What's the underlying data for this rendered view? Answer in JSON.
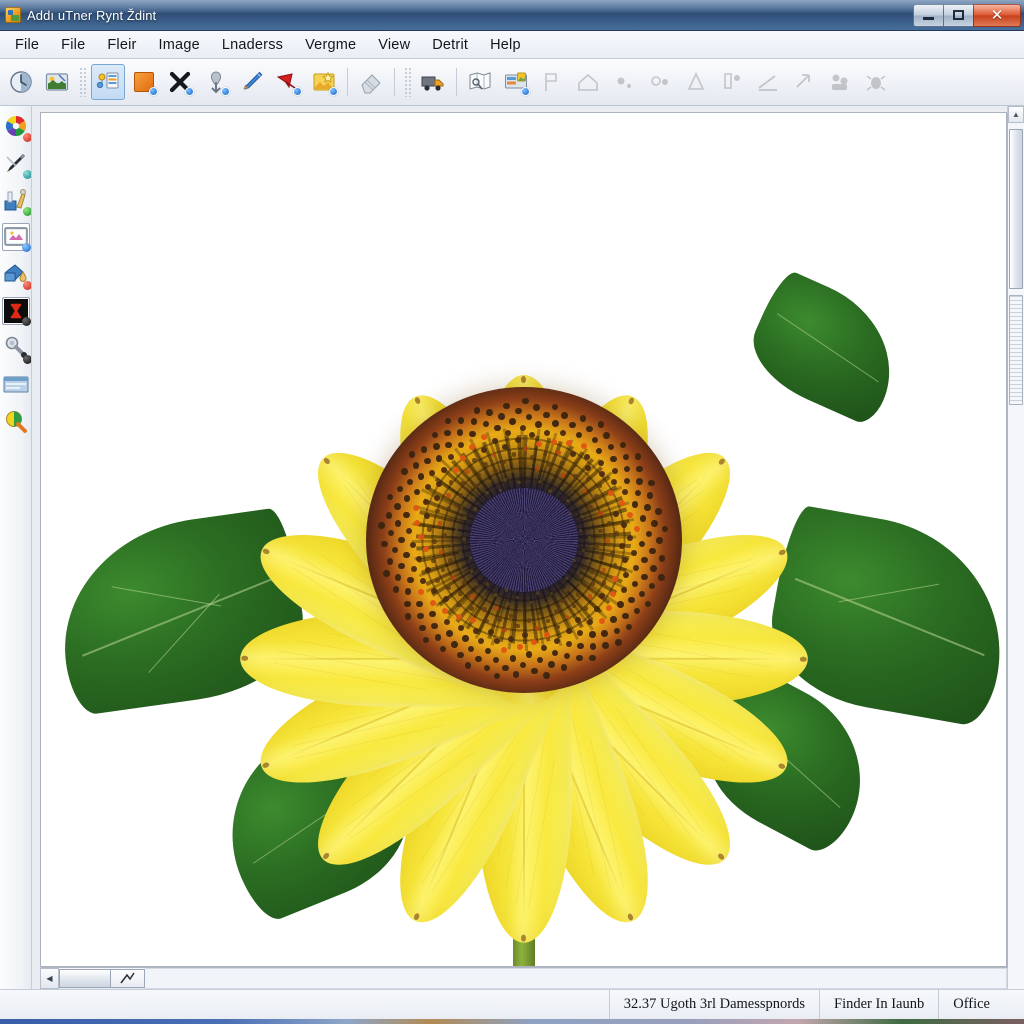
{
  "window": {
    "title": "Addı uTner Rynt Ždint",
    "app_icon": "image-editor-icon",
    "controls": {
      "minimize": "minimize-icon",
      "maximize": "maximize-icon",
      "close": "✕"
    }
  },
  "menubar": {
    "items": [
      {
        "label": "File"
      },
      {
        "label": "File"
      },
      {
        "label": "Fleir"
      },
      {
        "label": "Image"
      },
      {
        "label": "Lnaderss"
      },
      {
        "label": "Vergme"
      },
      {
        "label": "View"
      },
      {
        "label": "Detrit"
      },
      {
        "label": "Help"
      }
    ]
  },
  "toolbar": {
    "groups": [
      {
        "buttons": [
          {
            "name": "globe-clock-icon",
            "selected": false,
            "disabled": false,
            "badge": ""
          },
          {
            "name": "picture-preview-icon",
            "selected": false,
            "disabled": false,
            "badge": ""
          }
        ]
      },
      {
        "buttons": [
          {
            "name": "layers-panel-icon",
            "selected": true,
            "disabled": false,
            "badge": ""
          },
          {
            "name": "orange-square-icon",
            "selected": false,
            "disabled": false,
            "badge": "blue"
          },
          {
            "name": "delete-cross-icon",
            "selected": false,
            "disabled": false,
            "badge": "blue"
          },
          {
            "name": "pin-marker-icon",
            "selected": false,
            "disabled": false,
            "badge": "blue"
          },
          {
            "name": "pencil-icon",
            "selected": false,
            "disabled": false,
            "badge": ""
          },
          {
            "name": "red-arrow-icon",
            "selected": false,
            "disabled": false,
            "badge": "blue"
          },
          {
            "name": "image-star-icon",
            "selected": false,
            "disabled": false,
            "badge": "blue"
          }
        ]
      },
      {
        "buttons": [
          {
            "name": "eraser-icon",
            "selected": false,
            "disabled": false,
            "badge": ""
          }
        ]
      },
      {
        "buttons": [
          {
            "name": "truck-export-icon",
            "selected": false,
            "disabled": false,
            "badge": ""
          }
        ]
      },
      {
        "buttons": [
          {
            "name": "map-region-icon",
            "selected": false,
            "disabled": false,
            "badge": ""
          },
          {
            "name": "import-image-icon",
            "selected": false,
            "disabled": false,
            "badge": "blue"
          },
          {
            "name": "shape-flag-icon",
            "selected": false,
            "disabled": true,
            "badge": ""
          },
          {
            "name": "shape-house-icon",
            "selected": false,
            "disabled": true,
            "badge": ""
          },
          {
            "name": "shape-dot-icon",
            "selected": false,
            "disabled": true,
            "badge": ""
          },
          {
            "name": "shape-circle-icon",
            "selected": false,
            "disabled": true,
            "badge": ""
          },
          {
            "name": "shape-person-icon",
            "selected": false,
            "disabled": true,
            "badge": ""
          },
          {
            "name": "shape-people-icon",
            "selected": false,
            "disabled": true,
            "badge": ""
          },
          {
            "name": "shape-ramp-icon",
            "selected": false,
            "disabled": true,
            "badge": ""
          },
          {
            "name": "shape-arrow-icon",
            "selected": false,
            "disabled": true,
            "badge": ""
          },
          {
            "name": "shape-group-icon",
            "selected": false,
            "disabled": true,
            "badge": ""
          },
          {
            "name": "shape-bug-icon",
            "selected": false,
            "disabled": true,
            "badge": ""
          }
        ]
      }
    ]
  },
  "tool_palette": {
    "tools": [
      {
        "name": "color-wheel-tool",
        "dot": "red",
        "active": false
      },
      {
        "name": "brush-pencil-tool",
        "dot": "teal",
        "active": false
      },
      {
        "name": "paint-supplies-tool",
        "dot": "green",
        "active": false
      },
      {
        "name": "screen-preview-tool",
        "dot": "blue",
        "active": true
      },
      {
        "name": "paint-bucket-tool",
        "dot": "red",
        "active": false
      },
      {
        "name": "text-cursor-tool",
        "dot": "black",
        "active": true
      },
      {
        "name": "magnifier-wrench-tool",
        "dot": "black",
        "active": false
      },
      {
        "name": "window-frame-tool",
        "dot": "",
        "active": false
      },
      {
        "name": "color-picker-tool",
        "dot": "",
        "active": false
      }
    ]
  },
  "canvas": {
    "image_name": "sunflower",
    "background": "#ffffff",
    "subject": {
      "petal_count": 16,
      "petal_color": "#f9e93f",
      "petal_highlight": "#fdf36e",
      "leaf_color": "#2b6d22",
      "disc_outer_color": "#8a6a1e",
      "disc_gold_color": "#e8ab17",
      "disc_core_color": "#241b40",
      "stem_color": "#7aa032"
    }
  },
  "scrollbars": {
    "vertical": {
      "up_arrow": "▲",
      "down_arrow": "▼"
    },
    "horizontal": {
      "left_arrow": "◀",
      "right_arrow": "▶"
    }
  },
  "statusbar": {
    "cells": [
      {
        "text": "32.37 Ugoth 3rl Damesspnords"
      },
      {
        "text": "Finder In Iaunb"
      },
      {
        "text": "Office"
      }
    ]
  }
}
